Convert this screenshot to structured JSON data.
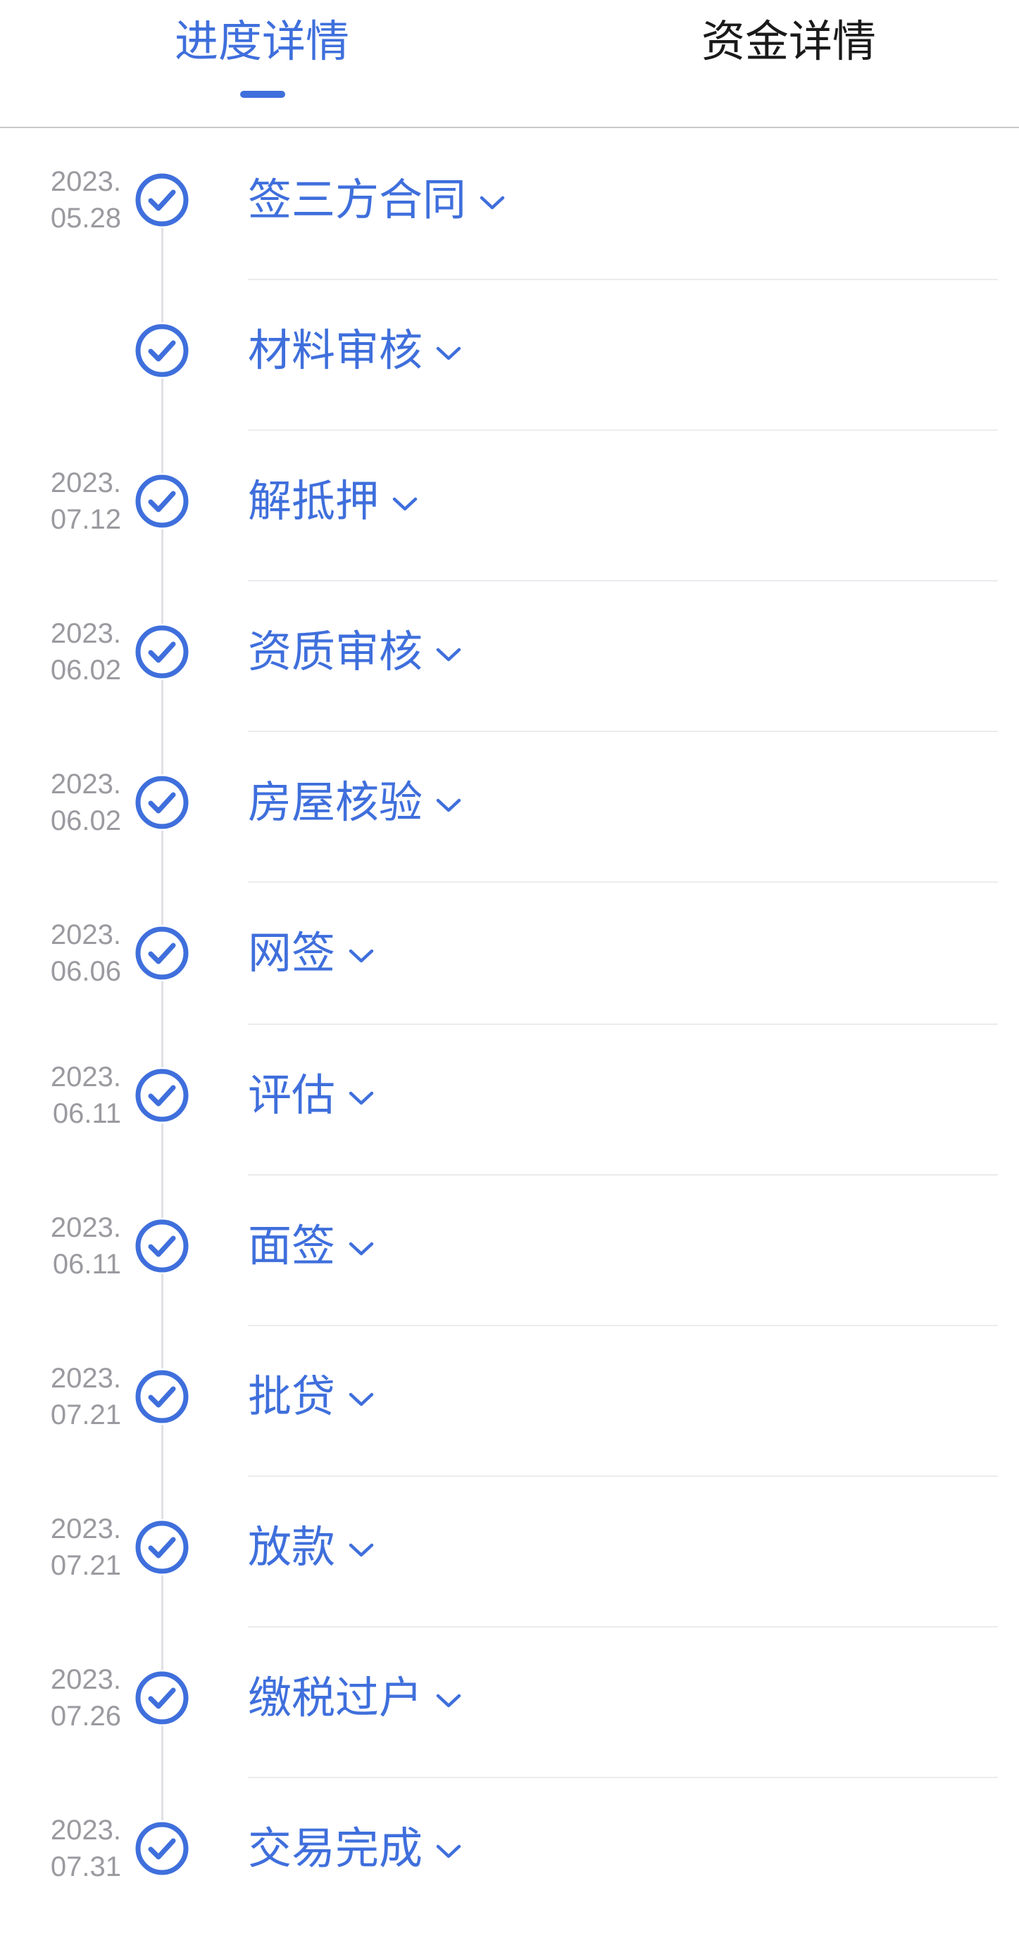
{
  "tabs": [
    {
      "label": "进度详情",
      "active": true
    },
    {
      "label": "资金详情",
      "active": false
    }
  ],
  "colors": {
    "accent": "#3f6fdc",
    "date": "#9a9aa0",
    "divider": "#ececef"
  },
  "steps": [
    {
      "title": "签三方合同",
      "date_year": "2023.",
      "date_md": "05.28"
    },
    {
      "title": "材料审核",
      "date_year": "",
      "date_md": ""
    },
    {
      "title": "解抵押",
      "date_year": "2023.",
      "date_md": "07.12"
    },
    {
      "title": "资质审核",
      "date_year": "2023.",
      "date_md": "06.02"
    },
    {
      "title": "房屋核验",
      "date_year": "2023.",
      "date_md": "06.02"
    },
    {
      "title": "网签",
      "date_year": "2023.",
      "date_md": "06.06"
    },
    {
      "title": "评估",
      "date_year": "2023.",
      "date_md": "06.11"
    },
    {
      "title": "面签",
      "date_year": "2023.",
      "date_md": "06.11"
    },
    {
      "title": "批贷",
      "date_year": "2023.",
      "date_md": "07.21"
    },
    {
      "title": "放款",
      "date_year": "2023.",
      "date_md": "07.21"
    },
    {
      "title": "缴税过户",
      "date_year": "2023.",
      "date_md": "07.26"
    },
    {
      "title": "交易完成",
      "date_year": "2023.",
      "date_md": "07.31"
    }
  ],
  "icons": {
    "step_status": "check-circle-icon",
    "expand": "chevron-down-icon"
  }
}
